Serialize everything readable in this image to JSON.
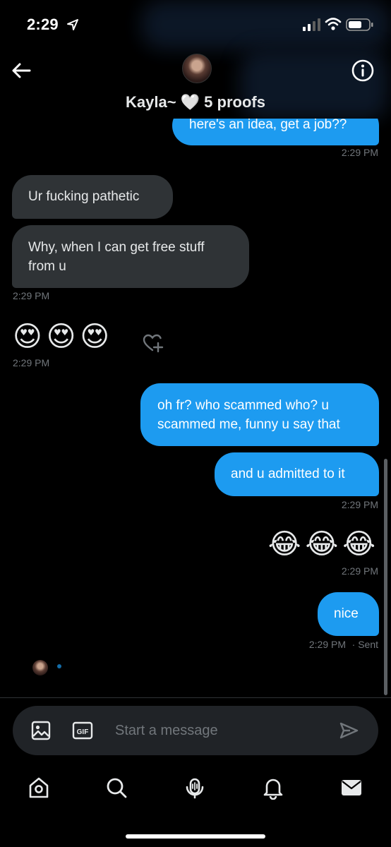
{
  "status_bar": {
    "time": "2:29",
    "icons": [
      "location-arrow-icon",
      "cellular-signal-icon",
      "wifi-icon",
      "battery-icon"
    ]
  },
  "header": {
    "name": "Kayla~ 🤍 5 proofs",
    "icons": [
      "back-arrow-icon",
      "info-icon"
    ]
  },
  "messages": [
    {
      "from": "me",
      "text": "here's an idea, get a job??",
      "time": "2:29 PM"
    },
    {
      "from": "them",
      "text": "Ur fucking pathetic"
    },
    {
      "from": "them",
      "text": "Why, when I can get free stuff\nfrom u",
      "time": "2:29 PM"
    },
    {
      "from": "them",
      "text": "😍😍😍",
      "time": "2:29 PM",
      "icon": "add-reaction-icon"
    },
    {
      "from": "me",
      "text": "oh fr? who scammed who? u\nscammed me, funny u say that"
    },
    {
      "from": "me",
      "text": "and u admitted to it",
      "time": "2:29 PM"
    },
    {
      "from": "me",
      "text": "😂😂😂",
      "time": "2:29 PM"
    },
    {
      "from": "me",
      "text": "nice",
      "time": "2:29 PM",
      "status": "· Sent"
    }
  ],
  "composer": {
    "placeholder": "Start a message",
    "gif_label": "GIF",
    "icons": [
      "image-icon",
      "gif-icon",
      "send-icon"
    ]
  },
  "tabbar": {
    "items": [
      "home-icon",
      "search-icon",
      "spaces-icon",
      "notifications-icon",
      "messages-icon"
    ]
  },
  "colors": {
    "background": "#000000",
    "bubble_in": "#2f3336",
    "bubble_out": "#1d9bf0",
    "timestamp": "#71767b"
  }
}
